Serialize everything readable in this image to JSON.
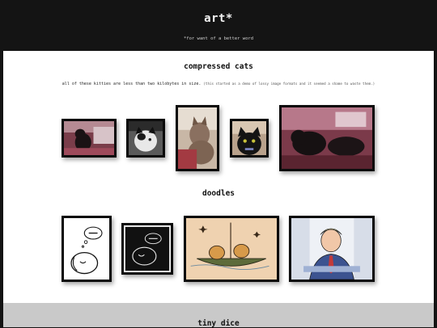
{
  "header": {
    "title": "art*",
    "subtitle": "*for want of a better word"
  },
  "sections": {
    "cats": {
      "title": "compressed cats",
      "intro": "all of these kitties are less than two kilobytes in size.",
      "aside": "(this started as a demo of lossy image formats and it seemed a shame to waste them.)"
    },
    "doodles": {
      "title": "doodles"
    },
    "dice": {
      "title": "tiny dice"
    }
  },
  "colors": {
    "header_bg": "#141414",
    "page_bg": "#ffffff",
    "band_bg": "#c9c9c9",
    "frame": "#0a0a0a"
  }
}
